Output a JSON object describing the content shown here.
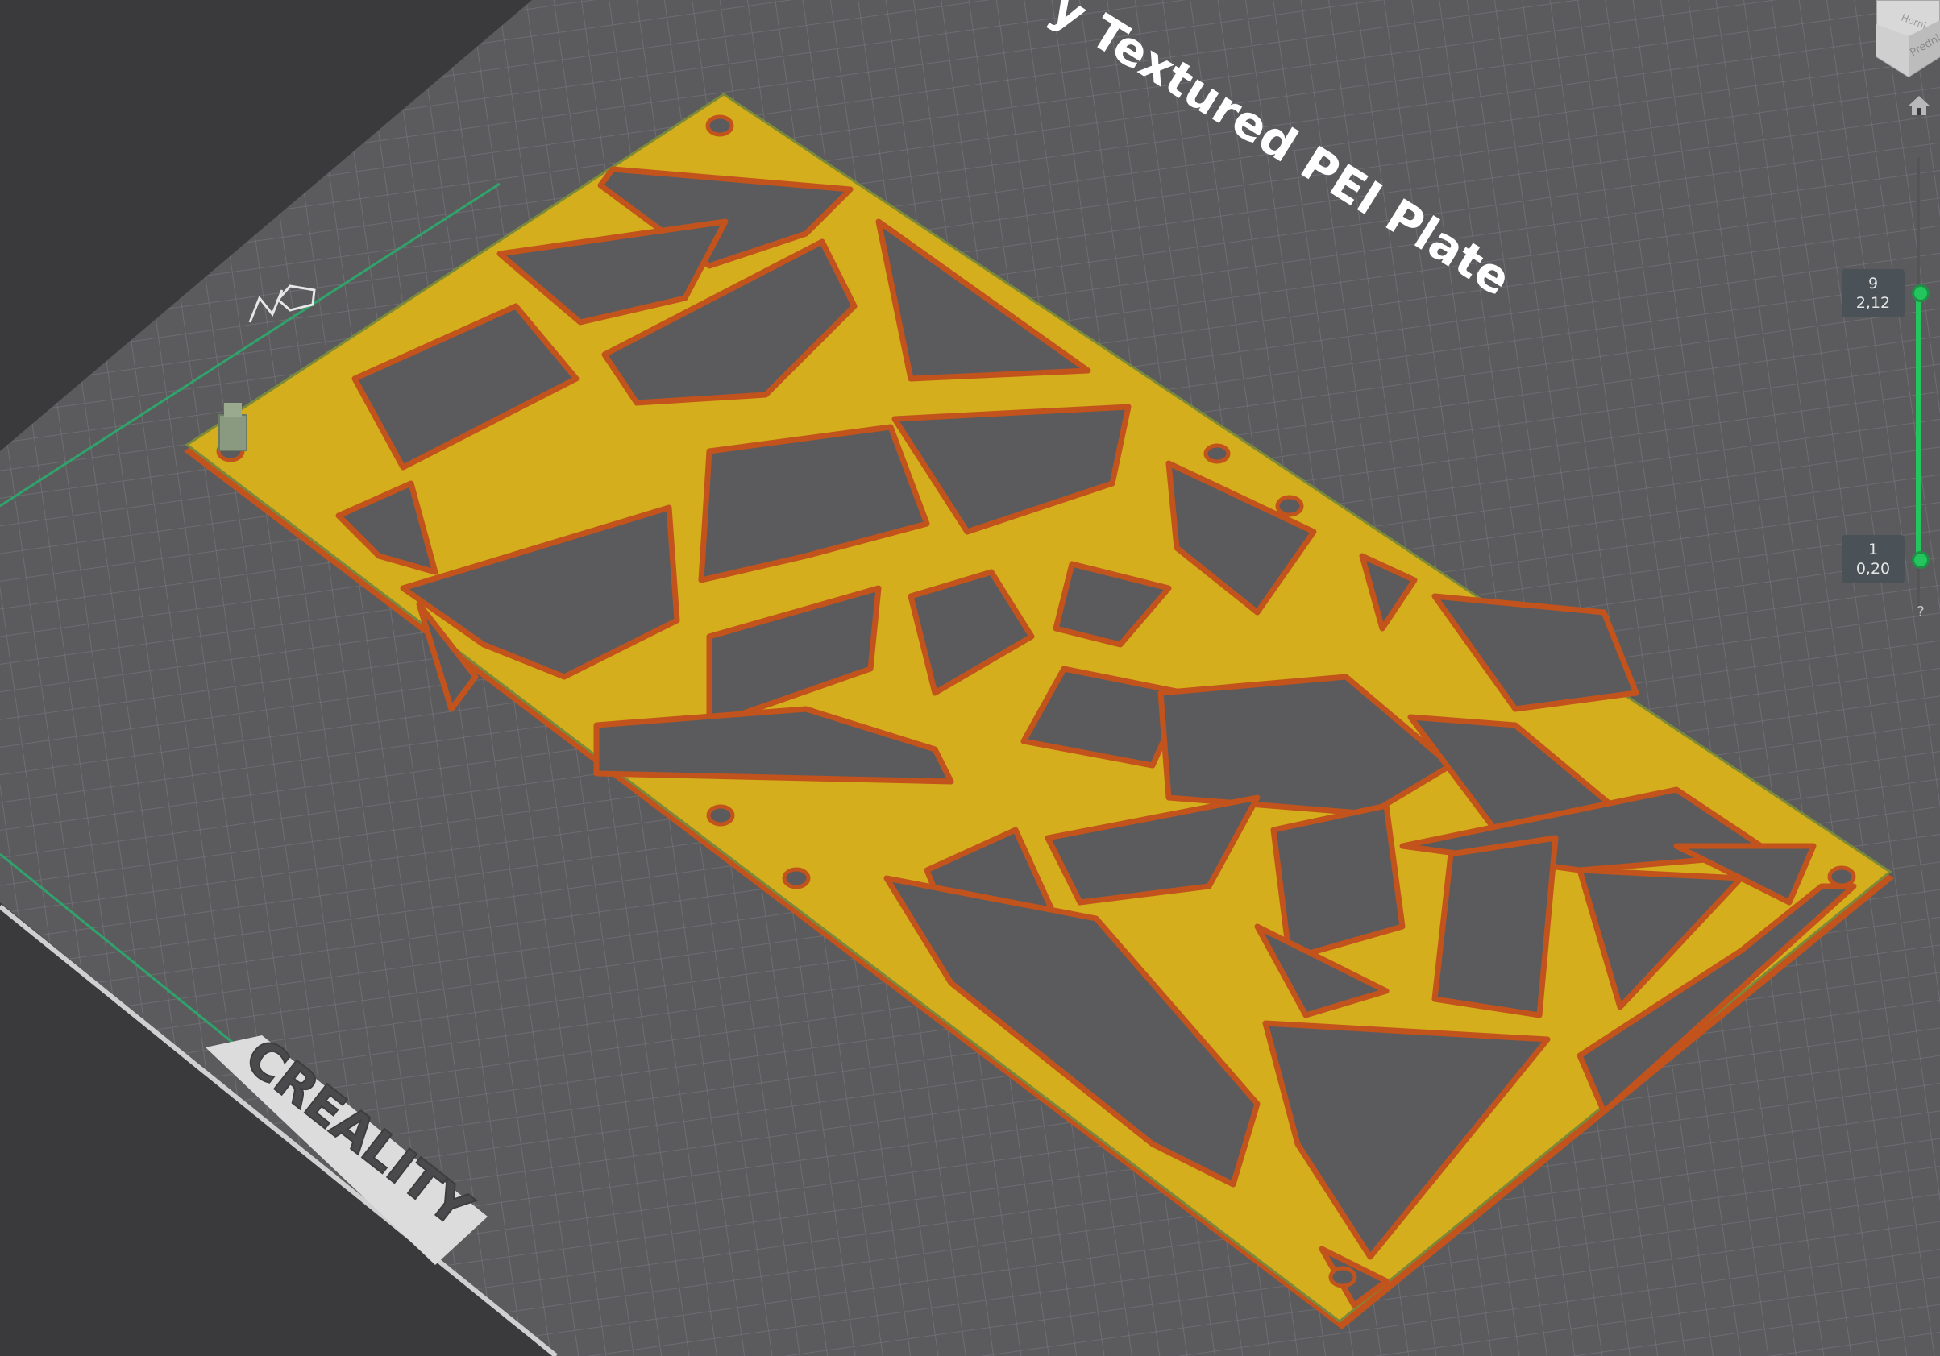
{
  "viewport": {
    "plate_label": "y Textured PEI Plate",
    "logo_text": "CREALITY",
    "colors": {
      "background": "#3a3a3c",
      "bed": "#5b5b5e",
      "grid": "#7a7a7e",
      "print_fill": "#d4ae1c",
      "print_edge": "#c2531c",
      "axis_green": "#2fa36b"
    }
  },
  "view_cube": {
    "face_text": "Predni",
    "top_text": "Horni"
  },
  "layer_slider": {
    "max_layer": "9",
    "max_height": "2,12",
    "min_layer": "1",
    "min_height": "0,20",
    "help": "?"
  }
}
